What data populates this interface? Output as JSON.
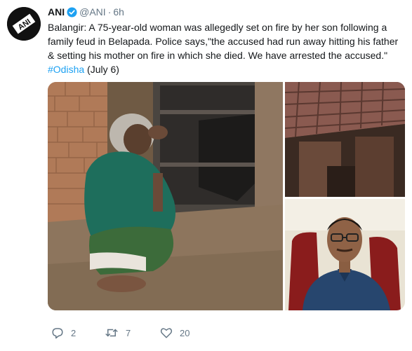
{
  "tweet": {
    "author_name": "ANI",
    "handle": "@ANI",
    "separator": "·",
    "time": "6h",
    "text": "Balangir: A 75-year-old woman was allegedly set on fire by her son following a family feud in Belapada. Police says,\"the accused had run away hitting his father & setting his mother on fire in which she died. We have arrested the accused.\"",
    "hashtag": "#Odisha",
    "date_note": " (July 6)",
    "counts": {
      "replies": "2",
      "retweets": "7",
      "likes": "20"
    }
  },
  "avatar": {
    "logo_text": "ANI"
  },
  "colors": {
    "link": "#1da1f2",
    "muted": "#657786",
    "text": "#14171a"
  },
  "icons": {
    "verified": "verified-badge-icon",
    "reply": "reply-icon",
    "retweet": "retweet-icon",
    "like": "heart-icon"
  }
}
